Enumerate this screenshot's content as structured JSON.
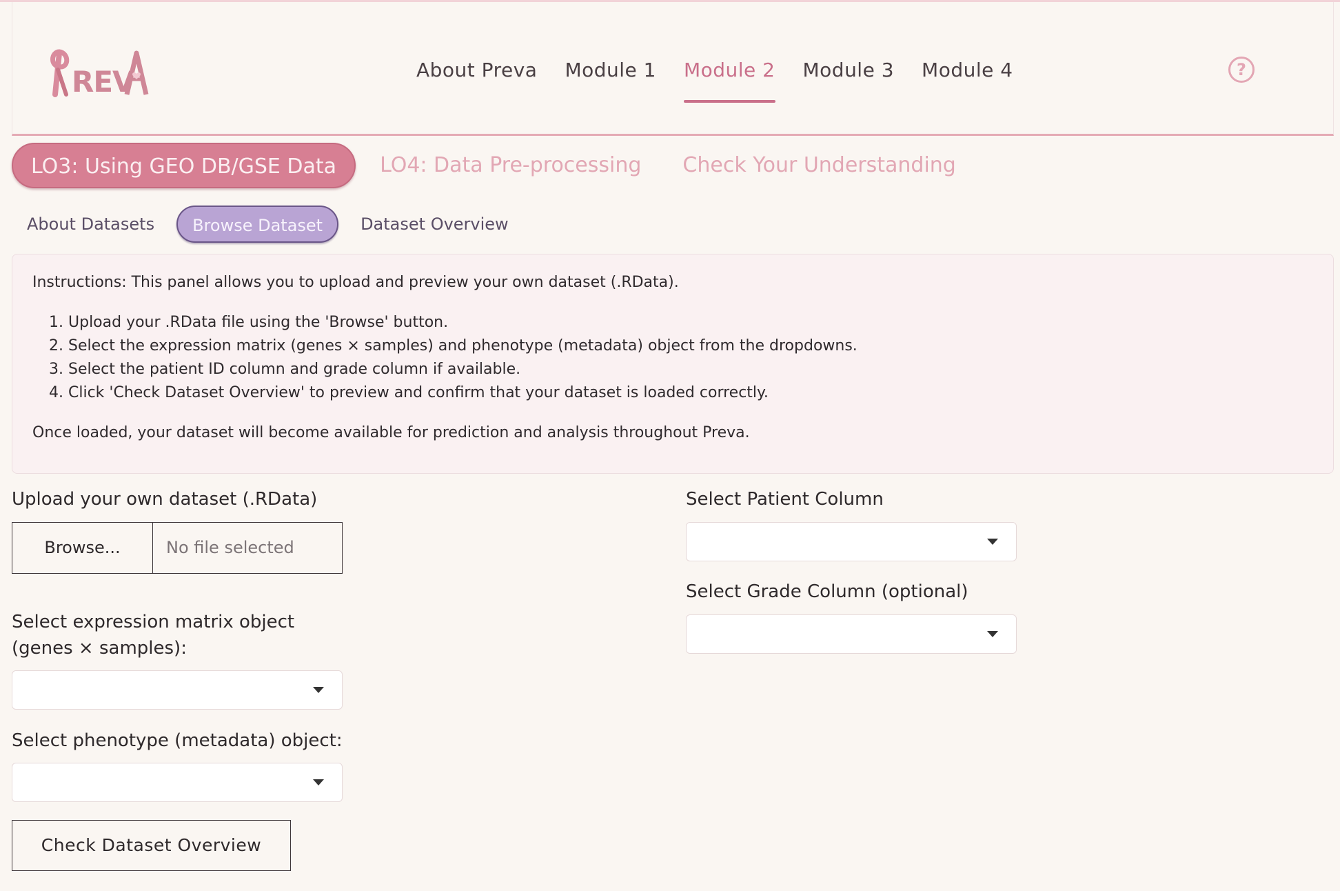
{
  "brand": {
    "logo_text": "PREVA",
    "colors": {
      "accent_pink": "#c96f8a",
      "tab_pink": "#d77f93",
      "tab_purple": "#b9a4d4",
      "background": "#faf6f2"
    }
  },
  "nav": {
    "items": [
      {
        "label": "About Preva",
        "active": false
      },
      {
        "label": "Module 1",
        "active": false
      },
      {
        "label": "Module 2",
        "active": true
      },
      {
        "label": "Module 3",
        "active": false
      },
      {
        "label": "Module 4",
        "active": false
      }
    ],
    "help_icon": "question-circle-icon",
    "help_glyph": "?"
  },
  "lo_tabs": [
    {
      "label": "LO3: Using GEO DB/GSE Data",
      "active": true
    },
    {
      "label": "LO4: Data Pre-processing",
      "active": false
    },
    {
      "label": "Check Your Understanding",
      "active": false
    }
  ],
  "sub_tabs": [
    {
      "label": "About Datasets",
      "active": false
    },
    {
      "label": "Browse Dataset",
      "active": true
    },
    {
      "label": "Dataset Overview",
      "active": false
    }
  ],
  "instructions": {
    "intro": "Instructions: This panel allows you to upload and preview your own dataset (.RData).",
    "steps": [
      "Upload your .RData file using the 'Browse' button.",
      "Select the expression matrix (genes × samples) and phenotype (metadata) object from the dropdowns.",
      "Select the patient ID column and grade column if available.",
      "Click 'Check Dataset Overview' to preview and confirm that your dataset is loaded correctly."
    ],
    "outro": "Once loaded, your dataset will become available for prediction and analysis throughout Preva."
  },
  "form": {
    "upload_label": "Upload your own dataset (.RData)",
    "browse_label": "Browse...",
    "file_placeholder": "No file selected",
    "expression_label_line1": "Select expression matrix object",
    "expression_label_line2": "(genes × samples):",
    "expression_value": "",
    "phenotype_label": "Select phenotype (metadata) object:",
    "phenotype_value": "",
    "patient_label": "Select Patient Column",
    "patient_value": "",
    "grade_label": "Select Grade Column (optional)",
    "grade_value": "",
    "check_button": "Check Dataset Overview"
  }
}
